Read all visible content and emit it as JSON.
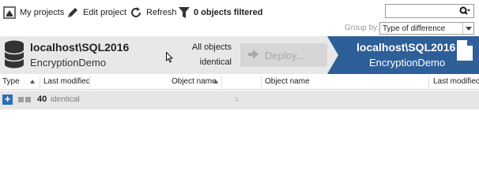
{
  "toolbar": {
    "my_projects_label": "My projects",
    "edit_project_label": "Edit project",
    "refresh_label": "Refresh",
    "filter_status_label": "0 objects filtered"
  },
  "search": {
    "value": "",
    "placeholder": ""
  },
  "group_by": {
    "label": "Group by:",
    "selected": "Type of difference"
  },
  "source": {
    "server": "localhost\\SQL2016",
    "database": "EncryptionDemo"
  },
  "summary": {
    "line1": "All objects",
    "line2": "identical"
  },
  "deploy": {
    "label": "Deploy..."
  },
  "target": {
    "server": "localhost\\SQL2016",
    "database": "EncryptionDemo"
  },
  "columns": {
    "type": "Type",
    "last_modified_left": "Last modified",
    "object_name_left": "Object name",
    "object_name_right": "Object name",
    "last_modified_right": "Last modified"
  },
  "group": {
    "count": "40",
    "label": "identical",
    "symbol": "="
  },
  "colors": {
    "accent": "#2e5f98",
    "band": "#e8e8e8",
    "expand": "#2d6fb5"
  }
}
